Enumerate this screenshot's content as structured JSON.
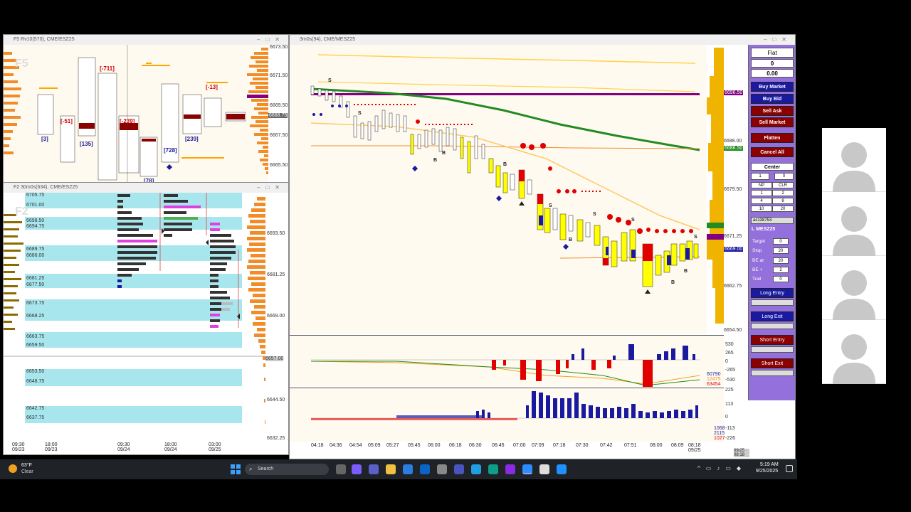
{
  "window_left_top": {
    "title": "F5 Rv10(570), CME/ESZ25",
    "corner_label": "F5",
    "prices": [
      "6673.50",
      "6671.50",
      "6669.50",
      "6668.75",
      "6667.50",
      "6665.50"
    ],
    "bracket_labels": [
      "[-711]",
      "[-51]",
      "[-239]",
      "[-13]",
      "[3]",
      "[135]",
      "[728]",
      "[239]",
      "[78]"
    ]
  },
  "window_left_bottom": {
    "title": "F2 30m0s(634), CME/ESZ25",
    "corner_label": "F2",
    "level_labels": [
      "6705.75",
      "6701.00",
      "6698.50",
      "6694.75",
      "6689.75",
      "6686.00",
      "6681.25",
      "6677.50",
      "6673.75",
      "6668.25",
      "6663.75",
      "6659.50",
      "6653.50",
      "6648.75",
      "6642.75",
      "6637.75"
    ],
    "prices": [
      "6693.50",
      "6681.25",
      "6669.00",
      "6657.00",
      "6644.50",
      "6632.25"
    ],
    "highlight_price": "6657.00",
    "time_labels": [
      {
        "t": "09:30",
        "d": "09/23"
      },
      {
        "t": "18:00",
        "d": "09/23"
      },
      {
        "t": "09:30",
        "d": "09/24"
      },
      {
        "t": "18:00",
        "d": "09/24"
      },
      {
        "t": "03:00",
        "d": "09/25"
      }
    ]
  },
  "window_main": {
    "title": "3m0s(94), CME/MESZ25",
    "prices": [
      "6688.00",
      "6679.50",
      "6671.25",
      "6662.75",
      "6654.50"
    ],
    "price_tags": {
      "upper": "6696.50",
      "green": "6686.50",
      "current": "6669.00"
    },
    "volume_axis": [
      "530",
      "265",
      "0",
      "-265",
      "-530"
    ],
    "delta_readouts": [
      "60790",
      "12475",
      "63454"
    ],
    "bottom_axis": [
      "225",
      "113",
      "0",
      "-113",
      "-226"
    ],
    "bottom_readouts": [
      "1068",
      "2115",
      "1027"
    ],
    "time_labels": [
      "04:18",
      "04:36",
      "04:54",
      "05:09",
      "05:27",
      "05:45",
      "06:00",
      "06:18",
      "06:30",
      "06:45",
      "07:00",
      "07:09",
      "07:18",
      "07:30",
      "07:42",
      "07:51",
      "08:00",
      "08:09",
      "08:18"
    ],
    "last_date": "09/25",
    "cursor_time": "09/25 08:18"
  },
  "panel": {
    "position": "Flat",
    "qty": "0",
    "pnl": "0.00",
    "buy_market": "Buy Market",
    "buy_bid": "Buy Bid",
    "sell_ask": "Sell Ask",
    "sell_market": "Sell Market",
    "flatten": "Flatten",
    "cancel_all": "Cancel All",
    "center": "Center",
    "qty_left": "1",
    "qty_right": "0",
    "grid": [
      "NP",
      "CLR",
      "1",
      "2",
      "4",
      "8",
      "10",
      "20"
    ],
    "account": "ac138753",
    "symbol": "L MESZ25",
    "target_label": "Target",
    "target": "0",
    "stop_label": "Stop",
    "stop": "20",
    "be_at_label": "BE at",
    "be_at": "20",
    "be_plus_label": "BE +",
    "be_plus": "2",
    "trail_label": "Trail",
    "trail": "0",
    "long_entry": "Long Entry",
    "long_exit": "Long Exit",
    "short_entry": "Short Entry",
    "short_exit": "Short Exit"
  },
  "taskbar": {
    "temperature": "63°F",
    "weather": "Clear",
    "search_placeholder": "Search",
    "time": "5:19 AM",
    "date": "9/25/2025"
  },
  "colors": {
    "buy": "#1a1aa0",
    "sell": "#8b0000",
    "panel": "#9370db",
    "cyan": "#a8e6ee",
    "yellow": "#ffff00"
  }
}
